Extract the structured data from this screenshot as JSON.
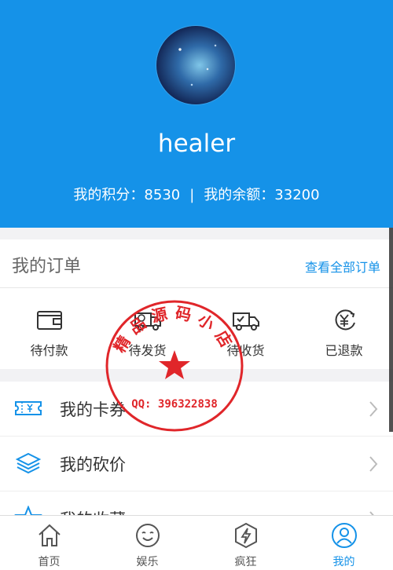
{
  "profile": {
    "username": "healer",
    "points_label": "我的积分：8530",
    "separator": "|",
    "balance_label": "我的余额：33200"
  },
  "orders": {
    "title": "我的订单",
    "view_all": "查看全部订单",
    "items": [
      {
        "label": "待付款",
        "icon": "wallet-icon"
      },
      {
        "label": "待发货",
        "icon": "truck-icon"
      },
      {
        "label": "待收货",
        "icon": "delivery-check-icon"
      },
      {
        "label": "已退款",
        "icon": "yen-refund-icon"
      }
    ]
  },
  "menu": {
    "items": [
      {
        "label": "我的卡券",
        "icon": "coupon-icon"
      },
      {
        "label": "我的砍价",
        "icon": "layers-icon"
      },
      {
        "label": "我的收藏",
        "icon": "star-icon"
      }
    ]
  },
  "tabbar": {
    "items": [
      {
        "label": "首页",
        "icon": "home-icon"
      },
      {
        "label": "娱乐",
        "icon": "smile-icon"
      },
      {
        "label": "疯狂",
        "icon": "bolt-icon"
      },
      {
        "label": "我的",
        "icon": "user-icon"
      }
    ],
    "active_index": 3
  },
  "watermark": {
    "top_text": "精品源码小店",
    "qq_text": "QQ: 396322838"
  },
  "colors": {
    "brand": "#1592e8",
    "stamp": "#e0262a"
  }
}
